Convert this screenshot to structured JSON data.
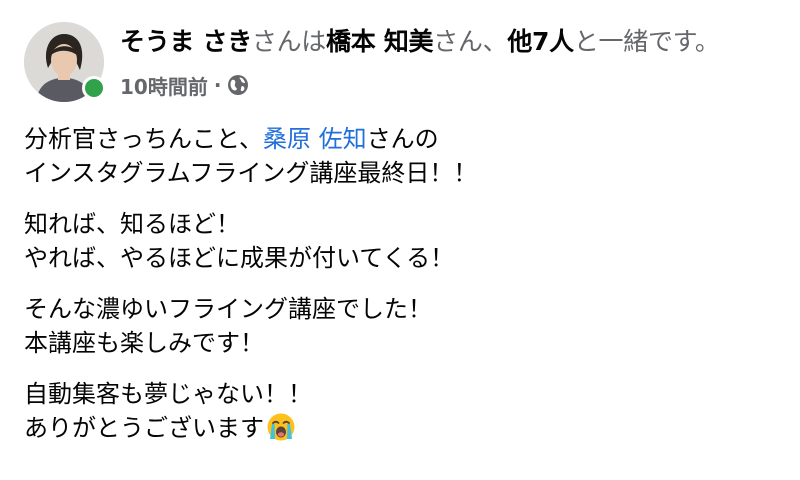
{
  "header": {
    "author_name": "そうま さき",
    "with_text": "さんは",
    "tagged_name": "橋本 知美",
    "suffix_san": "さん、",
    "others": "他7人",
    "trailing": "と一緒です。",
    "timestamp": "10時間前",
    "separator": "·",
    "privacy_icon": "globe-icon",
    "online_status": "online",
    "online_color": "#31a24c"
  },
  "post": {
    "para1": {
      "line1_prefix": "分析官さっちんこと、",
      "line1_mention": "桑原 佐知",
      "line1_suffix": "さんの",
      "line2": "インスタグラムフライング講座最終日！！"
    },
    "para2": {
      "line1": "知れば、知るほど！",
      "line2": "やれば、やるほどに成果が付いてくる！"
    },
    "para3": {
      "line1": "そんな濃ゆいフライング講座でした！",
      "line2": "本講座も楽しみです！"
    },
    "para4": {
      "line1": "自動集客も夢じゃない！！",
      "line2": "ありがとうございます",
      "emoji": "loudly-crying-face-icon"
    }
  },
  "colors": {
    "text": "#050505",
    "secondary": "#65676b",
    "mention": "#216fdb"
  }
}
